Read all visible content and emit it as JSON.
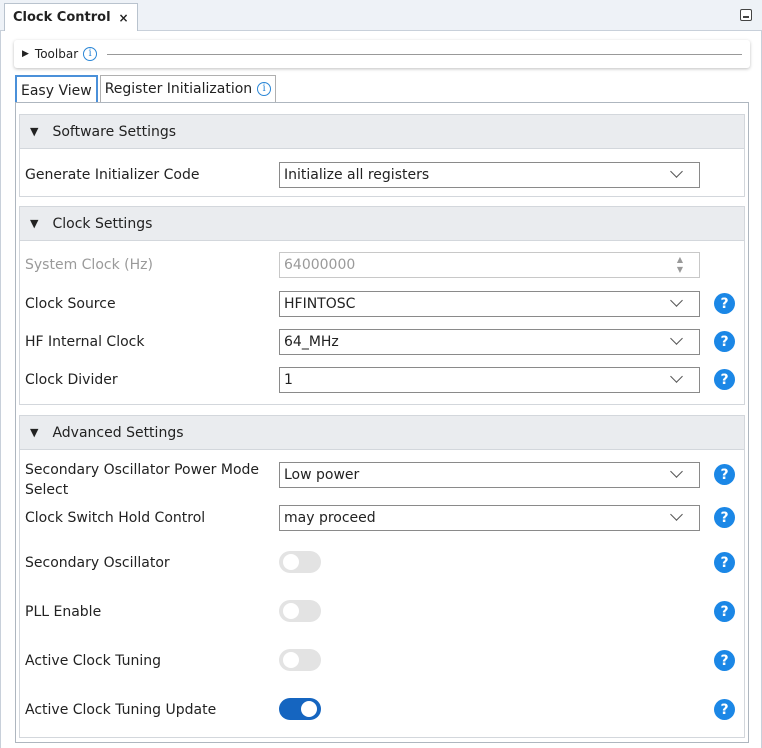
{
  "window": {
    "title": "Clock Control",
    "close_glyph": "×"
  },
  "toolbar": {
    "label": "Toolbar",
    "info_glyph": "i"
  },
  "tabs": [
    {
      "label": "Easy View",
      "active": true
    },
    {
      "label": "Register Initialization",
      "active": false,
      "info_glyph": "i"
    }
  ],
  "sections": {
    "software": {
      "title": "Software Settings",
      "rows": [
        {
          "label": "Generate Initializer Code",
          "value": "Initialize all registers"
        }
      ]
    },
    "clock": {
      "title": "Clock Settings",
      "rows": [
        {
          "label": "System Clock (Hz)",
          "value": "64000000"
        },
        {
          "label": "Clock Source",
          "value": "HFINTOSC"
        },
        {
          "label": "HF Internal Clock",
          "value": "64_MHz"
        },
        {
          "label": "Clock Divider",
          "value": "1"
        }
      ]
    },
    "advanced": {
      "title": "Advanced Settings",
      "rows": [
        {
          "label": "Secondary Oscillator Power Mode Select",
          "value": "Low power"
        },
        {
          "label": "Clock Switch Hold Control",
          "value": "may proceed"
        },
        {
          "label": "Secondary Oscillator",
          "toggle": false
        },
        {
          "label": "PLL Enable",
          "toggle": false
        },
        {
          "label": "Active Clock Tuning",
          "toggle": false
        },
        {
          "label": "Active Clock Tuning Update",
          "toggle": true
        }
      ]
    }
  },
  "help_glyph": "?",
  "colors": {
    "accent": "#1b87e6",
    "toggle_on": "#1565c0",
    "toggle_off": "#e3e3e3"
  }
}
